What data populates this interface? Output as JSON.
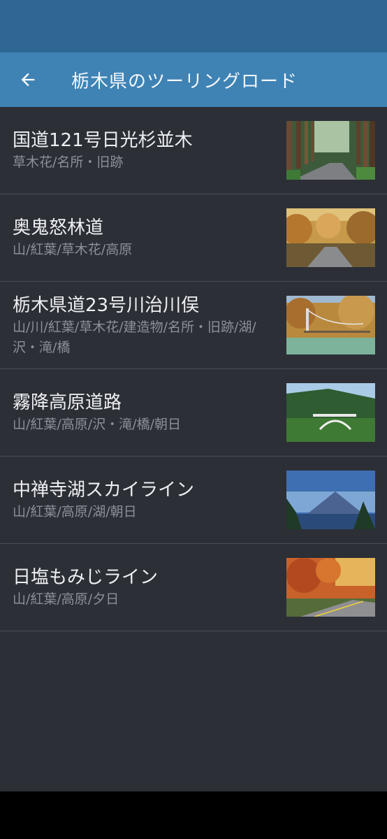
{
  "header": {
    "title": "栃木県のツーリングロード",
    "back_icon": "arrow-left-icon"
  },
  "colors": {
    "status_bar": "#2e6791",
    "app_bar": "#3f83b5",
    "background": "#2c2f36",
    "title_text": "#eef0f2",
    "tag_text": "#8c9097"
  },
  "roads": [
    {
      "title": "国道121号日光杉並木",
      "tags": "草木花/名所・旧跡",
      "thumbnail": "cedar-avenue-photo"
    },
    {
      "title": "奥鬼怒林道",
      "tags": "山/紅葉/草木花/高原",
      "thumbnail": "autumn-forest-road-photo"
    },
    {
      "title": "栃木県道23号川治川俣",
      "tags": "山/川/紅葉/草木花/建造物/名所・旧跡/湖/沢・滝/橋",
      "thumbnail": "suspension-bridge-photo"
    },
    {
      "title": "霧降高原道路",
      "tags": "山/紅葉/高原/沢・滝/橋/朝日",
      "thumbnail": "arch-bridge-photo"
    },
    {
      "title": "中禅寺湖スカイライン",
      "tags": "山/紅葉/高原/湖/朝日",
      "thumbnail": "mountain-lake-photo"
    },
    {
      "title": "日塩もみじライン",
      "tags": "山/紅葉/高原/夕日",
      "thumbnail": "autumn-maple-road-photo"
    }
  ]
}
